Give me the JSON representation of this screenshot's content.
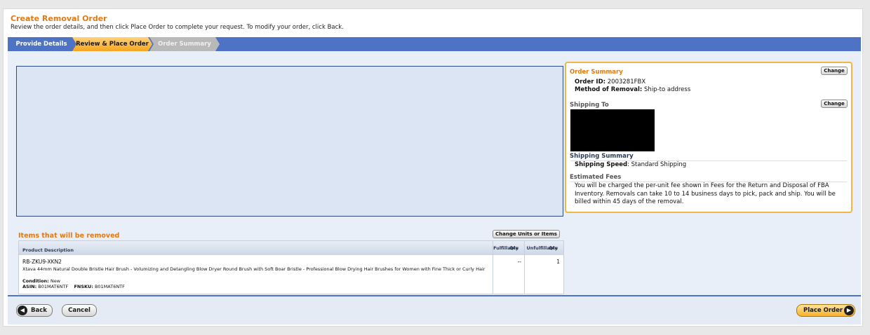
{
  "header": {
    "title": "Create Removal Order",
    "subtitle": "Review the order details, and then click Place Order to complete your request. To modify your order, click Back."
  },
  "steps": [
    {
      "label": "Provide Details",
      "state": "done"
    },
    {
      "label": "Review & Place Order",
      "state": "current"
    },
    {
      "label": "Order Summary",
      "state": "upcoming"
    }
  ],
  "order_summary": {
    "title": "Order Summary",
    "change_label": "Change",
    "order_id_label": "Order ID:",
    "order_id": "2003281FBX",
    "method_label": "Method of Removal:",
    "method": "Ship-to address"
  },
  "shipping_to": {
    "title": "Shipping To",
    "change_label": "Change"
  },
  "shipping_summary": {
    "title": "Shipping Summary",
    "speed_label": "Shipping Speed",
    "speed": ": Standard Shipping"
  },
  "estimated_fees": {
    "title": "Estimated Fees",
    "text": "You will be charged the per-unit fee shown in Fees for the Return and Disposal of FBA Inventory. Removals can take 10 to 14 business days to pick, pack and ship. You will be billed within 45 days of the removal."
  },
  "items": {
    "title": "Items that will be removed",
    "change_button": "Change Units or Items",
    "columns": {
      "description": "Product Description",
      "fulfillable_l1": "Fulfillable",
      "fulfillable_l2": "Qty",
      "unfulfillable_l1": "Unfulfillable",
      "unfulfillable_l2": "Qty"
    },
    "rows": [
      {
        "sku": "RB-ZKU9-XKN2",
        "name": "Xtava 44mm Natural Double Bristle Hair Brush - Volumizing and Detangling Blow Dryer Round Brush with Soft Boar Bristle - Professional Blow Drying Hair Brushes for Women with Fine Thick or Curly Hair",
        "condition_label": "Condition:",
        "condition": "New",
        "asin_label": "ASIN:",
        "asin": "B01MAT6NTF",
        "fnsku_label": "FNSKU:",
        "fnsku": "B01MAT6NTF",
        "fulfillable_qty": "--",
        "unfulfillable_qty": "1"
      }
    ]
  },
  "footer": {
    "back_label": "Back",
    "cancel_label": "Cancel",
    "place_order_label": "Place Order"
  },
  "colors": {
    "accent_orange": "#e47911",
    "step_blue": "#4f73c4",
    "panel_bg": "#e9eff8",
    "summary_border": "#f3b545"
  }
}
